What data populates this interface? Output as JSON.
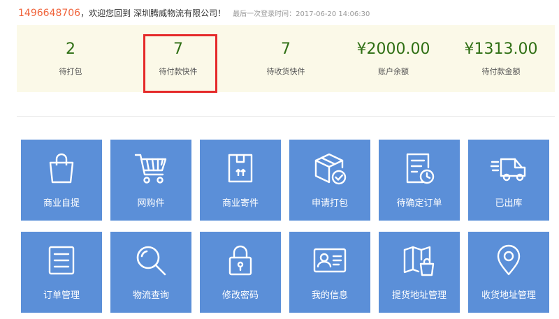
{
  "header": {
    "user_id": "1496648706",
    "welcome_text": "，欢迎您回到",
    "company": "深圳腾威物流有限公司！",
    "last_login": "最后一次登录时间：2017-06-20 14:06:30"
  },
  "stats": [
    {
      "value": "2",
      "label": "待打包"
    },
    {
      "value": "7",
      "label": "待付款快件"
    },
    {
      "value": "7",
      "label": "待收货快件"
    },
    {
      "value": "¥2000.00",
      "label": "账户余额"
    },
    {
      "value": "¥1313.00",
      "label": "待付款金额"
    }
  ],
  "colors": {
    "accent_orange": "#f0643c",
    "stat_green": "#2f6f14",
    "stats_bg": "#fbf9e8",
    "tile_blue": "#5b8fd8",
    "highlight_red": "#e52a2a"
  },
  "tiles": [
    {
      "label": "商业自提",
      "icon": "shopping-bag-icon"
    },
    {
      "label": "网购件",
      "icon": "shopping-cart-icon"
    },
    {
      "label": "商业寄件",
      "icon": "parcel-box-icon"
    },
    {
      "label": "申请打包",
      "icon": "package-check-icon"
    },
    {
      "label": "待确定订单",
      "icon": "pending-order-icon"
    },
    {
      "label": "已出库",
      "icon": "delivery-truck-icon"
    },
    {
      "label": "订单管理",
      "icon": "order-list-icon"
    },
    {
      "label": "物流查询",
      "icon": "search-icon"
    },
    {
      "label": "修改密码",
      "icon": "lock-icon"
    },
    {
      "label": "我的信息",
      "icon": "id-card-icon"
    },
    {
      "label": "提货地址管理",
      "icon": "map-bag-icon"
    },
    {
      "label": "收货地址管理",
      "icon": "location-pin-icon"
    }
  ]
}
